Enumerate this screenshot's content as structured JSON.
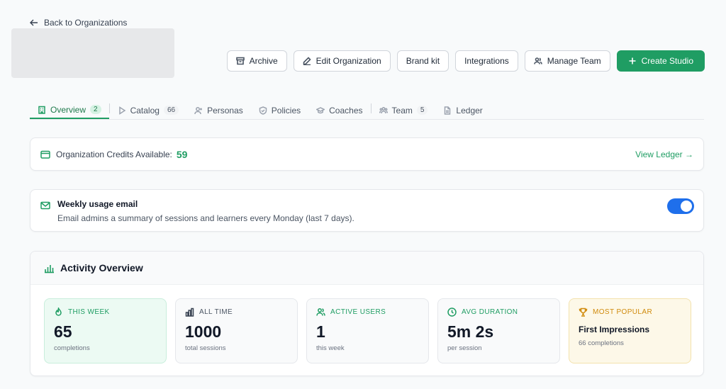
{
  "nav": {
    "back_label": "Back to Organizations"
  },
  "toolbar": {
    "archive": "Archive",
    "edit": "Edit Organization",
    "brand": "Brand kit",
    "integrations": "Integrations",
    "manage_team": "Manage Team",
    "create_studio": "Create Studio"
  },
  "tabs": [
    {
      "label": "Overview",
      "count": "2"
    },
    {
      "label": "Catalog",
      "count": "66"
    },
    {
      "label": "Personas"
    },
    {
      "label": "Policies"
    },
    {
      "label": "Coaches"
    },
    {
      "label": "Team",
      "count": "5"
    },
    {
      "label": "Ledger"
    }
  ],
  "credits": {
    "label": "Organization Credits Available:",
    "value": "59",
    "link": "View Ledger →"
  },
  "weekly": {
    "title": "Weekly usage email",
    "description": "Email admins a summary of sessions and learners every Monday (last 7 days).",
    "enabled": true
  },
  "activity": {
    "title": "Activity Overview",
    "stats": [
      {
        "label": "THIS WEEK",
        "value": "65",
        "sub": "completions",
        "color": "#1f9d63"
      },
      {
        "label": "ALL TIME",
        "value": "1000",
        "sub": "total sessions",
        "color": "#4b5563"
      },
      {
        "label": "ACTIVE USERS",
        "value": "1",
        "sub": "this week",
        "color": "#1f9d63"
      },
      {
        "label": "AVG DURATION",
        "value": "5m 2s",
        "sub": "per session",
        "color": "#1f9d63"
      }
    ],
    "popular": {
      "label": "MOST POPULAR",
      "name": "First Impressions",
      "sub": "66 completions",
      "color": "#d08a0b"
    }
  },
  "colors": {
    "accent": "#1f9d63",
    "toggle": "#1f6feb"
  }
}
